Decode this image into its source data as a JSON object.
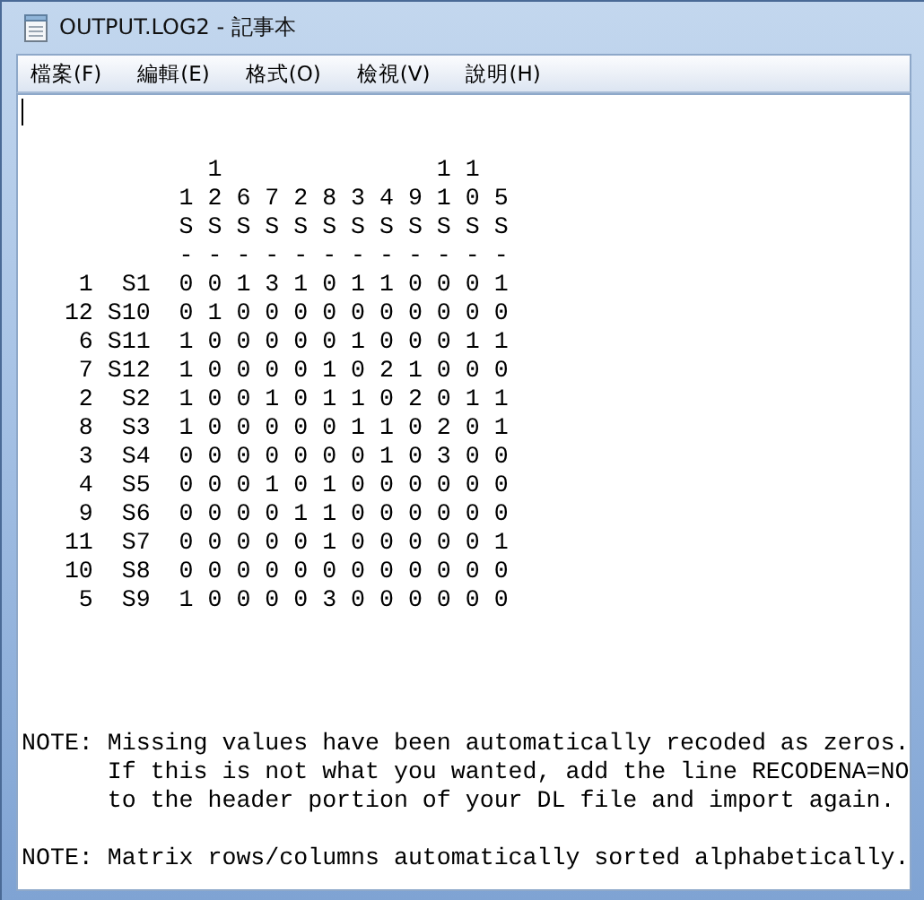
{
  "window": {
    "title": "OUTPUT.LOG2 - 記事本"
  },
  "menu": [
    {
      "label": "檔案(F)"
    },
    {
      "label": "編輯(E)"
    },
    {
      "label": "格式(O)"
    },
    {
      "label": "檢視(V)"
    },
    {
      "label": "說明(H)"
    }
  ],
  "document": {
    "text": "\n\n             1               1 1\n           1 2 6 7 2 8 3 4 9 1 0 5\n           S S S S S S S S S S S S\n           - - - - - - - - - - - -\n    1  S1  0 0 1 3 1 0 1 1 0 0 0 1\n   12 S10  0 1 0 0 0 0 0 0 0 0 0 0\n    6 S11  1 0 0 0 0 0 1 0 0 0 1 1\n    7 S12  1 0 0 0 0 1 0 2 1 0 0 0\n    2  S2  1 0 0 1 0 1 1 0 2 0 1 1\n    8  S3  1 0 0 0 0 0 1 1 0 2 0 1\n    3  S4  0 0 0 0 0 0 0 1 0 3 0 0\n    4  S5  0 0 0 1 0 1 0 0 0 0 0 0\n    9  S6  0 0 0 0 1 1 0 0 0 0 0 0\n   11  S7  0 0 0 0 0 1 0 0 0 0 0 1\n   10  S8  0 0 0 0 0 0 0 0 0 0 0 0\n    5  S9  1 0 0 0 0 3 0 0 0 0 0 0\n\n\n\n\nNOTE: Missing values have been automatically recoded as zeros.\n      If this is not what you wanted, add the line RECODENA=NO\n      to the header portion of your DL file and import again.\n\nNOTE: Matrix rows/columns automatically sorted alphabetically."
  }
}
